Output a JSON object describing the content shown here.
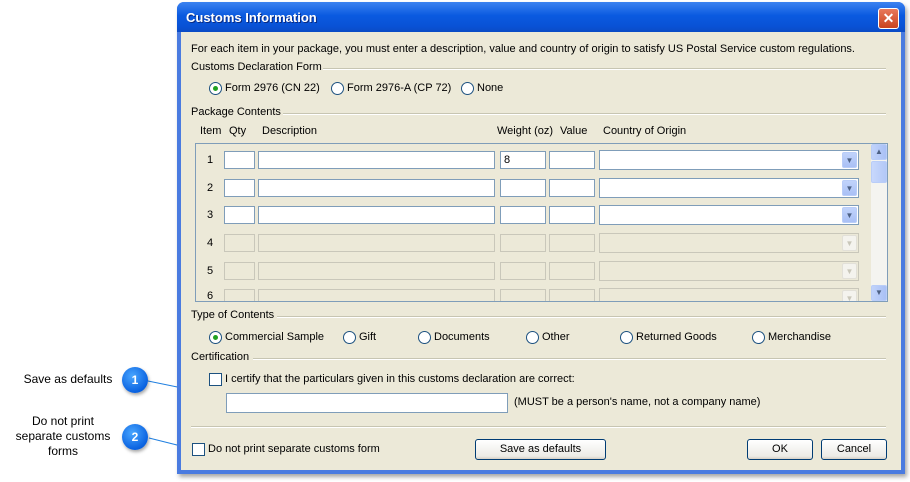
{
  "window": {
    "title": "Customs Information",
    "close_glyph": "✕",
    "intro": "For each item in your package, you must enter a description, value and country of origin to satisfy US Postal Service custom regulations."
  },
  "declaration": {
    "label": "Customs Declaration Form",
    "options": [
      "Form 2976 (CN 22)",
      "Form 2976-A (CP 72)",
      "None"
    ],
    "selected": "Form 2976 (CN 22)"
  },
  "package": {
    "label": "Package Contents",
    "headers": {
      "item": "Item",
      "qty": "Qty",
      "description": "Description",
      "weight": "Weight (oz)",
      "value": "Value",
      "country": "Country of Origin"
    },
    "rows": [
      {
        "num": "1",
        "qty": "",
        "description": "",
        "weight": "8",
        "value": "",
        "country": "",
        "enabled": true
      },
      {
        "num": "2",
        "qty": "",
        "description": "",
        "weight": "",
        "value": "",
        "country": "",
        "enabled": true
      },
      {
        "num": "3",
        "qty": "",
        "description": "",
        "weight": "",
        "value": "",
        "country": "",
        "enabled": true
      },
      {
        "num": "4",
        "qty": "",
        "description": "",
        "weight": "",
        "value": "",
        "country": "",
        "enabled": false
      },
      {
        "num": "5",
        "qty": "",
        "description": "",
        "weight": "",
        "value": "",
        "country": "",
        "enabled": false
      },
      {
        "num": "6",
        "qty": "",
        "description": "",
        "weight": "",
        "value": "",
        "country": "",
        "enabled": false
      }
    ]
  },
  "contents_type": {
    "label": "Type of Contents",
    "options": [
      "Commercial Sample",
      "Gift",
      "Documents",
      "Other",
      "Returned Goods",
      "Merchandise"
    ],
    "selected": "Commercial Sample"
  },
  "certification": {
    "label": "Certification",
    "checkbox_label": "I certify that the particulars given in this customs declaration are correct:",
    "checked": false,
    "name_value": "",
    "name_hint": "(MUST be a person's name, not a company name)"
  },
  "footer": {
    "no_print_label": "Do not print separate customs form",
    "no_print_checked": false,
    "save_defaults_label": "Save as defaults",
    "ok_label": "OK",
    "cancel_label": "Cancel"
  },
  "callouts": [
    {
      "number": "1",
      "text": "Save as defaults"
    },
    {
      "number": "2",
      "text": "Do not print separate customs forms"
    }
  ],
  "colors": {
    "titlebar": "#0a5ae0",
    "dialog_face": "#ece9d8",
    "callout": "#0a62e0",
    "callout_line": "#1f7fe0"
  }
}
